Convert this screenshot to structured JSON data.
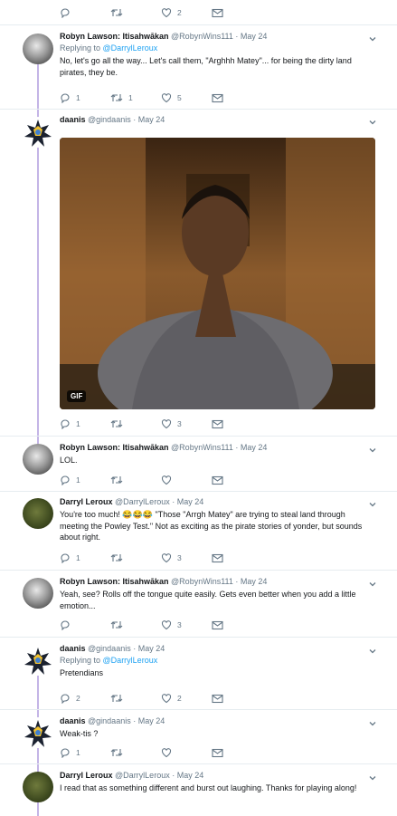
{
  "top_actions": {
    "reply_count": "",
    "retweet_count": "",
    "like_count": "2"
  },
  "tweets": [
    {
      "name": "Robyn Lawson: Itisahwākan",
      "handle": "@RobynWins111",
      "date": "May 24",
      "replying_prefix": "Replying to",
      "replying_to": "@DarrylLeroux",
      "text": "No, let's go all the way... Let's call them, \"Arghhh Matey\"... for being the dirty land pirates, they be.",
      "reply_count": "1",
      "retweet_count": "1",
      "like_count": "5"
    },
    {
      "name": "daanis",
      "handle": "@gindaanis",
      "date": "May 24",
      "gif_badge": "GIF",
      "reply_count": "1",
      "retweet_count": "",
      "like_count": "3"
    },
    {
      "name": "Robyn Lawson: Itisahwākan",
      "handle": "@RobynWins111",
      "date": "May 24",
      "text": "LOL.",
      "reply_count": "1",
      "retweet_count": "",
      "like_count": ""
    },
    {
      "name": "Darryl Leroux",
      "handle": "@DarrylLeroux",
      "date": "May 24",
      "text": "You're too much! 😂😂😂 \"Those \"Arrgh Matey\" are trying to steal land through meeting the Powley Test.\" Not as exciting as the pirate stories of yonder, but sounds about right.",
      "reply_count": "1",
      "retweet_count": "",
      "like_count": "3"
    },
    {
      "name": "Robyn Lawson: Itisahwākan",
      "handle": "@RobynWins111",
      "date": "May 24",
      "text": "Yeah, see?  Rolls off the tongue quite easily. Gets even better when you add a little emotion...",
      "reply_count": "",
      "retweet_count": "",
      "like_count": "3"
    },
    {
      "name": "daanis",
      "handle": "@gindaanis",
      "date": "May 24",
      "replying_prefix": "Replying to",
      "replying_to": "@DarrylLeroux",
      "text": "Pretendians",
      "reply_count": "2",
      "retweet_count": "",
      "like_count": "2"
    },
    {
      "name": "daanis",
      "handle": "@gindaanis",
      "date": "May 24",
      "text": "Weak-tis ?",
      "reply_count": "1",
      "retweet_count": "",
      "like_count": ""
    },
    {
      "name": "Darryl Leroux",
      "handle": "@DarrylLeroux",
      "date": "May 24",
      "text": "I read that as something different and burst out laughing. Thanks for playing along!",
      "reply_count": "",
      "retweet_count": "",
      "like_count": ""
    }
  ],
  "icons": {
    "reply": "reply-icon",
    "retweet": "retweet-icon",
    "like": "heart-icon",
    "message": "direct-message-icon",
    "caret": "chevron-down-icon"
  },
  "colors": {
    "link": "#1da1f2",
    "meta": "#657786",
    "thread_line": "#c4b5e6",
    "action_icon": "#657786"
  }
}
